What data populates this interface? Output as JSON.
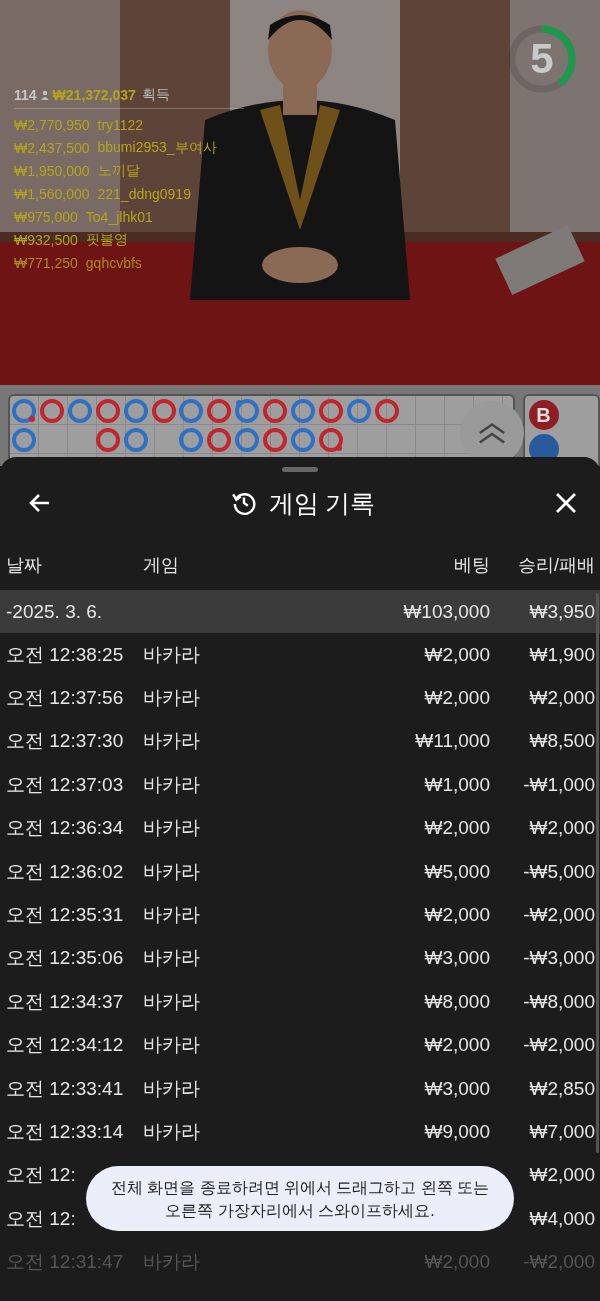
{
  "countdown": {
    "value": "5",
    "level": 0.4
  },
  "leaderboard": {
    "viewers": "114",
    "total": "₩21,372,037",
    "total_label": "획득",
    "entries": [
      {
        "amount": "₩2,770,950",
        "user": "try1122",
        "faded": false
      },
      {
        "amount": "₩2,437,500",
        "user": "bbumi2953_부여사",
        "faded": false
      },
      {
        "amount": "₩1,950,000",
        "user": "노끼달",
        "faded": false
      },
      {
        "amount": "₩1,560,000",
        "user": "221_ddng0919",
        "faded": false
      },
      {
        "amount": "₩975,000",
        "user": "To4_jlhk01",
        "faded": false
      },
      {
        "amount": "₩932,500",
        "user": "핏불영",
        "faded": false
      },
      {
        "amount": "₩771,250",
        "user": "gqhcvbfs",
        "faded": true
      }
    ]
  },
  "roadmap": {
    "rows": [
      [
        {
          "kind": "player",
          "banker_pair": true
        },
        {
          "kind": "banker"
        },
        {
          "kind": "player"
        },
        {
          "kind": "banker"
        },
        {
          "kind": "player"
        },
        {
          "kind": "banker"
        },
        {
          "kind": "player"
        },
        {
          "kind": "banker"
        },
        {
          "kind": "player",
          "player_pair": true
        },
        {
          "kind": "banker"
        },
        {
          "kind": "player"
        },
        {
          "kind": "banker"
        },
        {
          "kind": "player"
        },
        {
          "kind": "banker"
        }
      ],
      [
        {
          "kind": "player"
        },
        {
          "kind": "empty"
        },
        {
          "kind": "empty"
        },
        {
          "kind": "banker"
        },
        {
          "kind": "player"
        },
        {
          "kind": "empty"
        },
        {
          "kind": "player"
        },
        {
          "kind": "banker"
        },
        {
          "kind": "player"
        },
        {
          "kind": "banker"
        },
        {
          "kind": "player"
        },
        {
          "kind": "banker",
          "banker_pair": true
        }
      ]
    ],
    "side_badge": "B"
  },
  "sheet": {
    "title": "게임 기록",
    "columns": [
      "날짜",
      "게임",
      "베팅",
      "승리/패배"
    ],
    "groups": [
      {
        "date": "-2025. 3. 6.",
        "bet": "₩103,000",
        "result": "₩3,950",
        "rows": [
          {
            "time": "오전 12:38:25",
            "game": "바카라",
            "bet": "₩2,000",
            "result": "₩1,900",
            "faded": false
          },
          {
            "time": "오전 12:37:56",
            "game": "바카라",
            "bet": "₩2,000",
            "result": "₩2,000",
            "faded": false
          },
          {
            "time": "오전 12:37:30",
            "game": "바카라",
            "bet": "₩11,000",
            "result": "₩8,500",
            "faded": false
          },
          {
            "time": "오전 12:37:03",
            "game": "바카라",
            "bet": "₩1,000",
            "result": "-₩1,000",
            "faded": false
          },
          {
            "time": "오전 12:36:34",
            "game": "바카라",
            "bet": "₩2,000",
            "result": "₩2,000",
            "faded": false
          },
          {
            "time": "오전 12:36:02",
            "game": "바카라",
            "bet": "₩5,000",
            "result": "-₩5,000",
            "faded": false
          },
          {
            "time": "오전 12:35:31",
            "game": "바카라",
            "bet": "₩2,000",
            "result": "-₩2,000",
            "faded": false
          },
          {
            "time": "오전 12:35:06",
            "game": "바카라",
            "bet": "₩3,000",
            "result": "-₩3,000",
            "faded": false
          },
          {
            "time": "오전 12:34:37",
            "game": "바카라",
            "bet": "₩8,000",
            "result": "-₩8,000",
            "faded": false
          },
          {
            "time": "오전 12:34:12",
            "game": "바카라",
            "bet": "₩2,000",
            "result": "-₩2,000",
            "faded": false
          },
          {
            "time": "오전 12:33:41",
            "game": "바카라",
            "bet": "₩3,000",
            "result": "₩2,850",
            "faded": false
          },
          {
            "time": "오전 12:33:14",
            "game": "바카라",
            "bet": "₩9,000",
            "result": "₩7,000",
            "faded": false
          },
          {
            "time": "오전 12:",
            "result": "₩2,000",
            "faded": false
          },
          {
            "time": "오전 12:",
            "result": "₩4,000",
            "faded": false
          },
          {
            "time": "오전 12:31:47",
            "game": "바카라",
            "bet": "₩2,000",
            "result": "-₩2,000",
            "faded": true
          }
        ]
      }
    ]
  },
  "toast": "전체 화면을 종료하려면 위에서 드래그하고 왼쪽 또는 오른쪽 가장자리에서 스와이프하세요."
}
